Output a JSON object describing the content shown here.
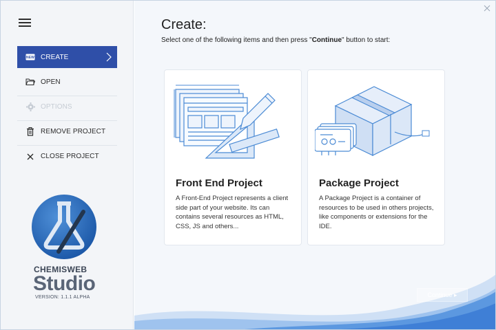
{
  "sidebar": {
    "items": [
      {
        "label": "CREATE",
        "icon": "new-icon",
        "active": true
      },
      {
        "label": "OPEN",
        "icon": "folder-open-icon"
      },
      {
        "label": "OPTIONS",
        "icon": "gear-icon",
        "disabled": true
      },
      {
        "label": "REMOVE PROJECT",
        "icon": "trash-icon"
      },
      {
        "label": "CLOSE PROJECT",
        "icon": "close-icon"
      }
    ],
    "new_badge": "NEW"
  },
  "brand": {
    "name": "CHEMISWEB",
    "product": "Studio",
    "version": "VERSION: 1.1.1 ALPHA"
  },
  "main": {
    "title": "Create:",
    "subtitle_before": "Select one of the following items and then press \"",
    "subtitle_bold": "Continue",
    "subtitle_after": "\" button to start:",
    "cards": [
      {
        "title": "Front End Project",
        "description": "A Front-End Project represents a client side part of your website. Its can contains several resources as HTML, CSS, JS and others..."
      },
      {
        "title": "Package Project",
        "description": "A Package Project is a container of resources to be used in others projects, like components or extensions for the IDE."
      }
    ],
    "continue_label": "Continue ▸"
  },
  "colors": {
    "accent": "#2f4fa8",
    "sidebar_bg": "#f3f5f8",
    "main_bg": "#f4f7fb",
    "wave": "#3f7fd6"
  }
}
